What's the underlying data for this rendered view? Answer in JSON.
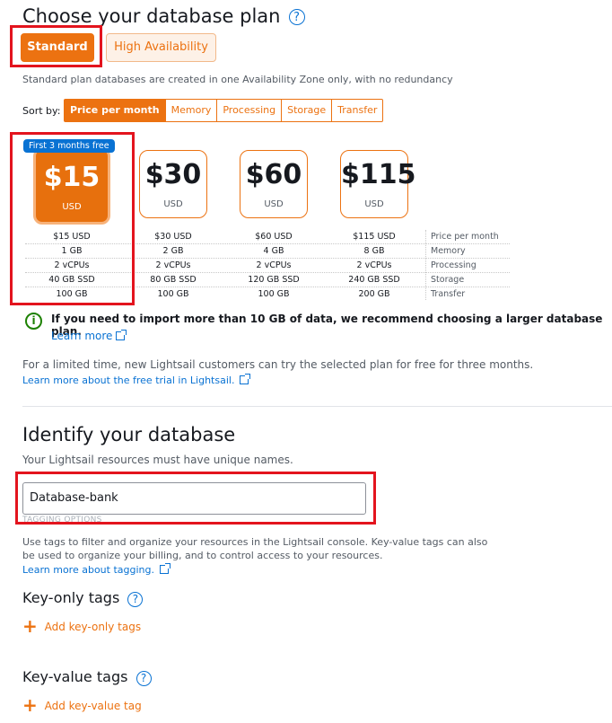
{
  "plan_section": {
    "title": "Choose your database plan",
    "help": "?",
    "buttons": {
      "standard": "Standard",
      "high_availability": "High Availability"
    },
    "description": "Standard plan databases are created in one Availability Zone only, with no redundancy"
  },
  "sort": {
    "label": "Sort by:",
    "options": [
      "Price per month",
      "Memory",
      "Processing",
      "Storage",
      "Transfer"
    ],
    "active": "Price per month"
  },
  "plans": [
    {
      "price": "$15",
      "currency": "USD",
      "badge": "First 3 months free",
      "specs": [
        "$15 USD",
        "1 GB",
        "2 vCPUs",
        "40 GB SSD",
        "100 GB"
      ]
    },
    {
      "price": "$30",
      "currency": "USD",
      "specs": [
        "$30 USD",
        "2 GB",
        "2 vCPUs",
        "80 GB SSD",
        "100 GB"
      ]
    },
    {
      "price": "$60",
      "currency": "USD",
      "specs": [
        "$60 USD",
        "4 GB",
        "2 vCPUs",
        "120 GB SSD",
        "100 GB"
      ]
    },
    {
      "price": "$115",
      "currency": "USD",
      "specs": [
        "$115 USD",
        "8 GB",
        "2 vCPUs",
        "240 GB SSD",
        "200 GB"
      ]
    }
  ],
  "spec_labels": [
    "Price per month",
    "Memory",
    "Processing",
    "Storage",
    "Transfer"
  ],
  "info": {
    "text": "If you need to import more than 10 GB of data, we recommend choosing a larger database plan.",
    "link": "Learn more"
  },
  "free_trial": {
    "text": "For a limited time, new Lightsail customers can try the selected plan for free for three months.",
    "link": "Learn more about the free trial in Lightsail."
  },
  "identify": {
    "title": "Identify your database",
    "subtitle": "Your Lightsail resources must have unique names.",
    "input_value": "Database-bank",
    "tagging_options": "TAGGING OPTIONS"
  },
  "tags": {
    "description_line1": "Use tags to filter and organize your resources in the Lightsail console. Key-value tags can also",
    "description_line2": "be used to organize your billing, and to control access to your resources.",
    "learn_link": "Learn more about tagging.",
    "key_only_title": "Key-only tags",
    "add_key_only": "Add key-only tags",
    "key_value_title": "Key-value tags",
    "add_key_value": "Add key-value tag"
  },
  "colors": {
    "accent": "#ec7211",
    "link": "#0972d3",
    "highlight": "#e3141e",
    "info": "#1d8102"
  }
}
